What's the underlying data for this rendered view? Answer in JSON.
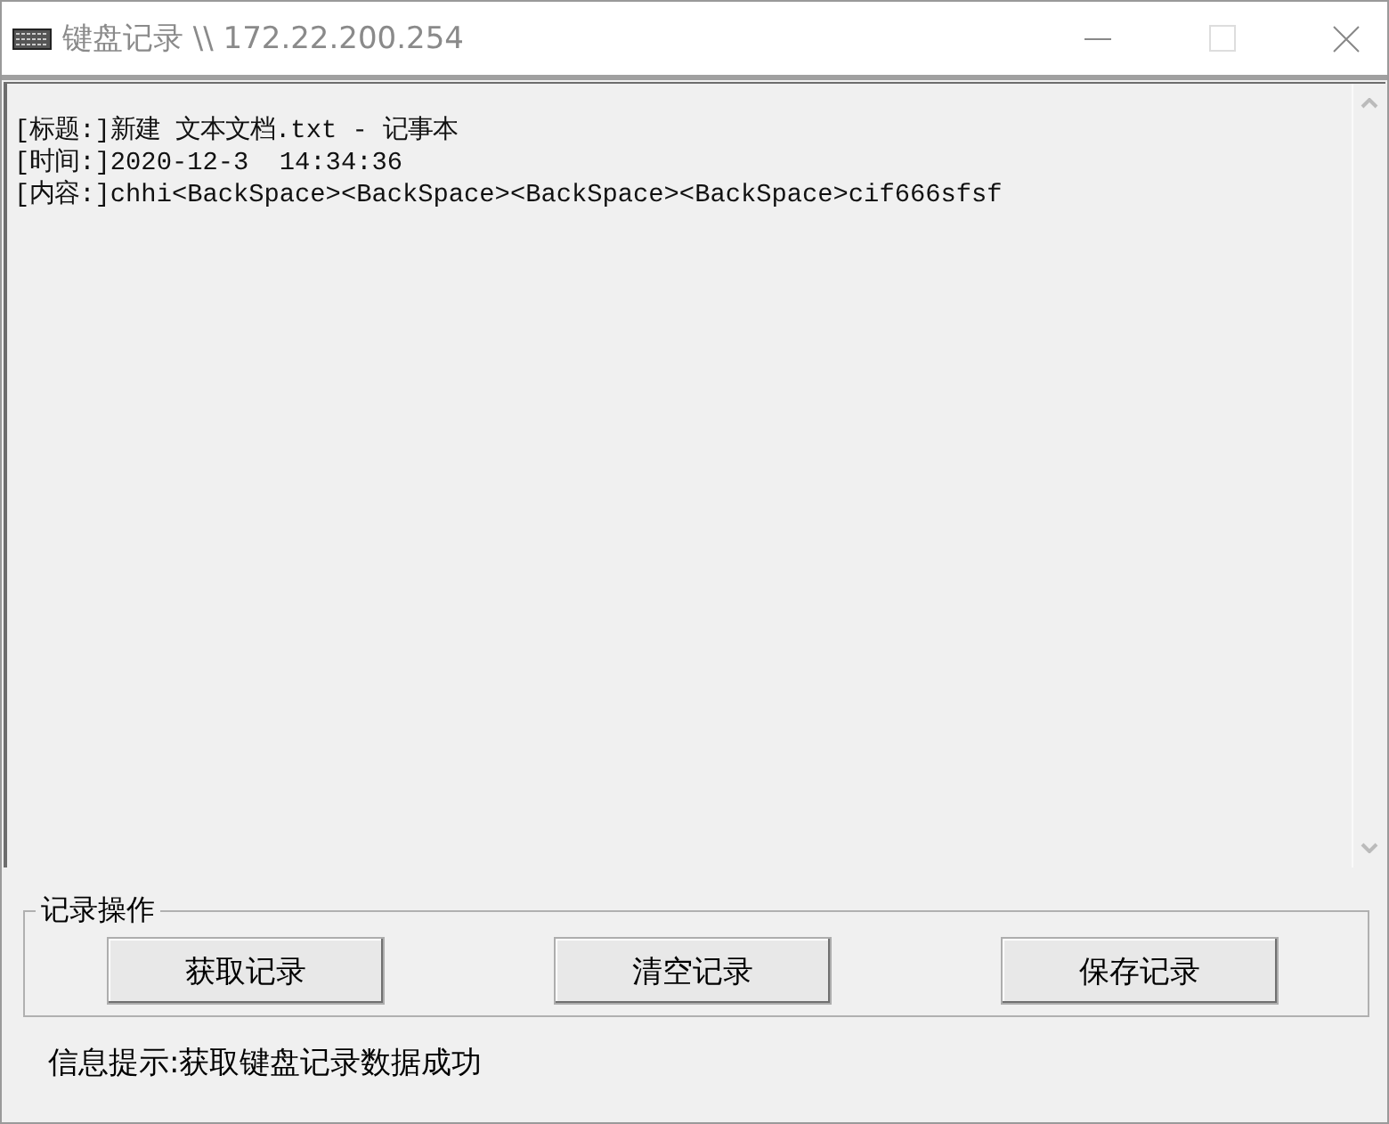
{
  "window": {
    "title": "键盘记录 \\\\ 172.22.200.254"
  },
  "log": {
    "lines": [
      "[标题:]新建 文本文档.txt - 记事本",
      "[时间:]2020-12-3  14:34:36",
      "[内容:]chhi<BackSpace><BackSpace><BackSpace><BackSpace>cif666sfsf"
    ]
  },
  "group": {
    "title": "记录操作",
    "buttons": [
      "获取记录",
      "清空记录",
      "保存记录"
    ]
  },
  "status": "信息提示:获取键盘记录数据成功"
}
